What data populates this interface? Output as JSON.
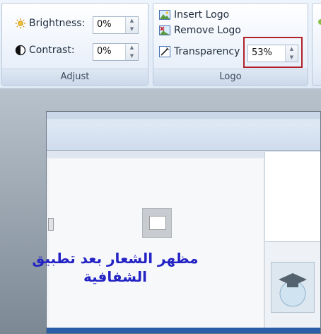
{
  "adjust_group": {
    "label": "Adjust",
    "brightness_label": "Brightness:",
    "brightness_value": "0%",
    "contrast_label": "Contrast:",
    "contrast_value": "0%"
  },
  "logo_group": {
    "label": "Logo",
    "insert_logo_label": "Insert Logo",
    "remove_logo_label": "Remove Logo",
    "transparency_label": "Transparency",
    "transparency_value": "53%"
  },
  "slide": {
    "caption_line1": "مظهر الشعار بعد تطبيق",
    "caption_line2": "الشفافية"
  },
  "colors": {
    "highlight_border": "#b0212a",
    "caption_text": "#2323c4"
  }
}
